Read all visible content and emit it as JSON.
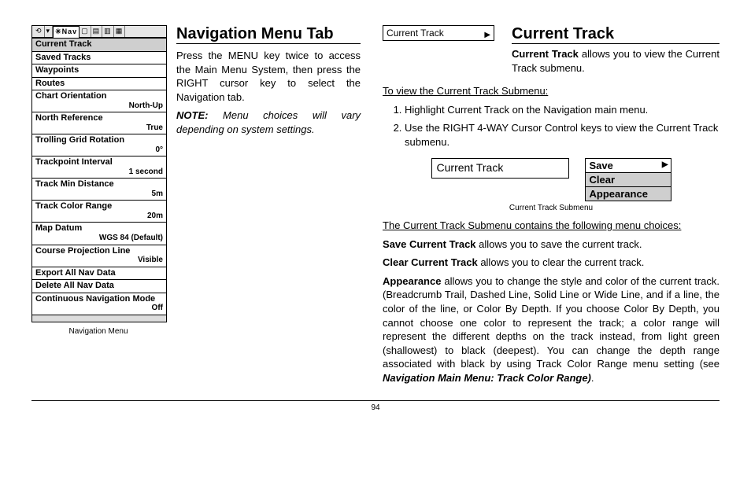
{
  "page_number": "94",
  "nav_menu": {
    "tabs_selected": "Nav",
    "items": [
      {
        "label": "Current Track",
        "highlight": true
      },
      {
        "label": "Saved Tracks"
      },
      {
        "label": "Waypoints"
      },
      {
        "label": "Routes"
      },
      {
        "label": "Chart Orientation",
        "value": "North-Up"
      },
      {
        "label": "North Reference",
        "value": "True"
      },
      {
        "label": "Trolling Grid Rotation",
        "value": "0°"
      },
      {
        "label": "Trackpoint Interval",
        "value": "1 second"
      },
      {
        "label": "Track Min Distance",
        "value": "5m"
      },
      {
        "label": "Track Color Range",
        "value": "20m"
      },
      {
        "label": "Map Datum",
        "value": "WGS 84 (Default)"
      },
      {
        "label": "Course Projection Line",
        "value": "Visible"
      },
      {
        "label": "Export All Nav Data"
      },
      {
        "label": "Delete All Nav Data"
      },
      {
        "label": "Continuous Navigation Mode",
        "value": "Off"
      }
    ],
    "caption": "Navigation Menu"
  },
  "left_section": {
    "title": "Navigation Menu Tab",
    "p1": "Press the MENU key twice to access the Main Menu System, then press the RIGHT cursor key to select the Navigation tab.",
    "note_label": "NOTE:",
    "note_body": " Menu choices will vary depending on system settings."
  },
  "right_section": {
    "ct_label": "Current Track",
    "title": "Current Track",
    "intro_bold": "Current Track",
    "intro_rest": " allows you to view the Current Track submenu.",
    "sub_heading": "To view the Current Track Submenu:",
    "steps": [
      "Highlight Current Track on the Navigation main menu.",
      "Use the RIGHT 4-WAY Cursor Control keys to view the Current Track submenu."
    ],
    "fig_left": "Current Track",
    "fig_items": [
      "Save",
      "Clear",
      "Appearance"
    ],
    "fig_caption": "Current Track Submenu",
    "choices_heading": "The Current Track Submenu contains the following menu choices:",
    "save_b": "Save Current Track",
    "save_r": " allows you to save the current track.",
    "clear_b": "Clear Current Track",
    "clear_r": " allows you to clear the current track.",
    "app_b": "Appearance",
    "app_r": " allows you to change the style and color of the current track. (Breadcrumb Trail, Dashed Line, Solid Line or Wide Line, and if a line, the color of the line, or Color By Depth. If you choose Color By Depth, you cannot choose one color to represent the track; a color range will represent the different depths on the track instead, from light green (shallowest) to black (deepest). You can change the depth range associated with black by using Track Color Range menu setting (see ",
    "app_ref": "Navigation Main Menu: Track Color Range)",
    "app_end": "."
  }
}
